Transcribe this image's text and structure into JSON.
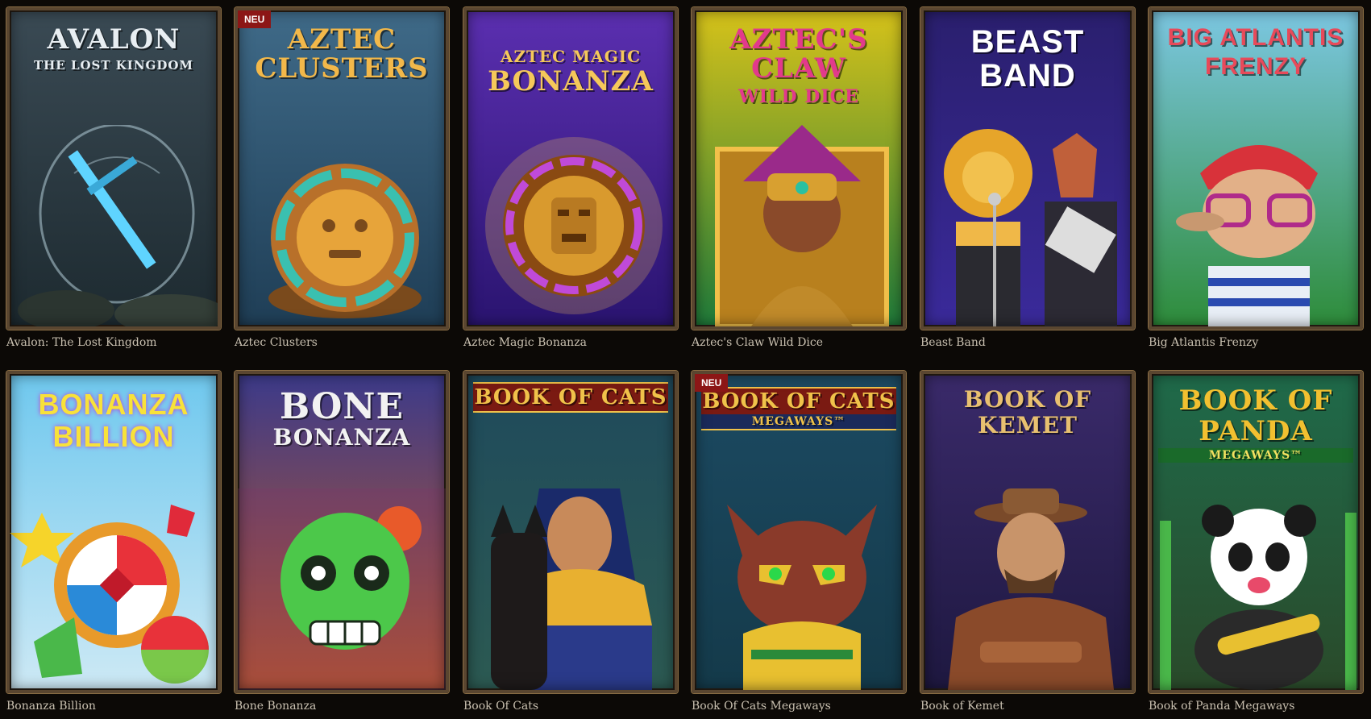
{
  "games": [
    {
      "title": "Avalon: The Lost Kingdom",
      "logo_main": "AVALON",
      "logo_sub": "THE LOST KINGDOM",
      "badge": "",
      "icon": "sword-icon",
      "bg": [
        "#3a4a54",
        "#1d2a30"
      ],
      "logo_color": "#e8eef2"
    },
    {
      "title": "Aztec Clusters",
      "logo_main": "AZTEC CLUSTERS",
      "logo_sub": "",
      "badge": "NEU",
      "icon": "golden-mask-disc-icon",
      "bg": [
        "#3f6a88",
        "#1f3e56"
      ],
      "logo_color": "#f2b84a"
    },
    {
      "title": "Aztec Magic Bonanza",
      "logo_main": "BONANZA",
      "logo_sub": "AZTEC MAGIC",
      "badge": "",
      "icon": "golden-medallion-icon",
      "bg": [
        "#5b2fb0",
        "#2a1470"
      ],
      "logo_color": "#f5c85a"
    },
    {
      "title": "Aztec's Claw Wild Dice",
      "logo_main": "AZTEC'S CLAW",
      "logo_sub": "WILD DICE",
      "badge": "",
      "icon": "aztec-warrior-woman-icon",
      "bg": [
        "#d6c21a",
        "#1f7a3a"
      ],
      "logo_color": "#e23a8c"
    },
    {
      "title": "Beast Band",
      "logo_main": "BEAST BAND",
      "logo_sub": "",
      "badge": "",
      "icon": "lion-singer-icon",
      "bg": [
        "#2a1f6e",
        "#3a2a9a"
      ],
      "logo_color": "#ffffff"
    },
    {
      "title": "Big Atlantis Frenzy",
      "logo_main": "BIG ATLANTIS",
      "logo_sub": "FRENZY",
      "badge": "",
      "icon": "cartoon-sailor-icon",
      "bg": [
        "#7cc7e2",
        "#2e8c3a"
      ],
      "logo_color": "#e84a5a"
    },
    {
      "title": "Bonanza Billion",
      "logo_main": "BONANZA BILLION",
      "logo_sub": "",
      "badge": "",
      "icon": "candy-clover-icon",
      "bg": [
        "#6fc8ee",
        "#cde9f5"
      ],
      "logo_color": "#f8e23a"
    },
    {
      "title": "Bone Bonanza",
      "logo_main": "BONE",
      "logo_sub": "BONANZA",
      "badge": "",
      "icon": "green-skull-icon",
      "bg": [
        "#3c3a8a",
        "#c45a20"
      ],
      "logo_color": "#f2f2f2"
    },
    {
      "title": "Book Of Cats",
      "logo_main": "BOOK OF CATS",
      "logo_sub": "",
      "badge": "",
      "icon": "egyptian-queen-cat-icon",
      "bg": [
        "#1f4a5c",
        "#2c5a52"
      ],
      "logo_color": "#f0c24a"
    },
    {
      "title": "Book Of Cats Megaways",
      "logo_main": "BOOK OF CATS",
      "logo_sub": "MEGAWAYS™",
      "badge": "NEU",
      "icon": "egyptian-cat-icon",
      "bg": [
        "#1c4a62",
        "#143a4a"
      ],
      "logo_color": "#f0c24a"
    },
    {
      "title": "Book of Kemet",
      "logo_main": "BOOK OF KEMET",
      "logo_sub": "",
      "badge": "",
      "icon": "cowboy-explorer-icon",
      "bg": [
        "#3a2a6a",
        "#1e1840"
      ],
      "logo_color": "#e8c070"
    },
    {
      "title": "Book of Panda Megaways",
      "logo_main": "BOOK OF PANDA",
      "logo_sub": "MEGAWAYS™",
      "badge": "",
      "icon": "panda-icon",
      "bg": [
        "#1f6a4a",
        "#2a4a2a"
      ],
      "logo_color": "#f2c030"
    }
  ]
}
